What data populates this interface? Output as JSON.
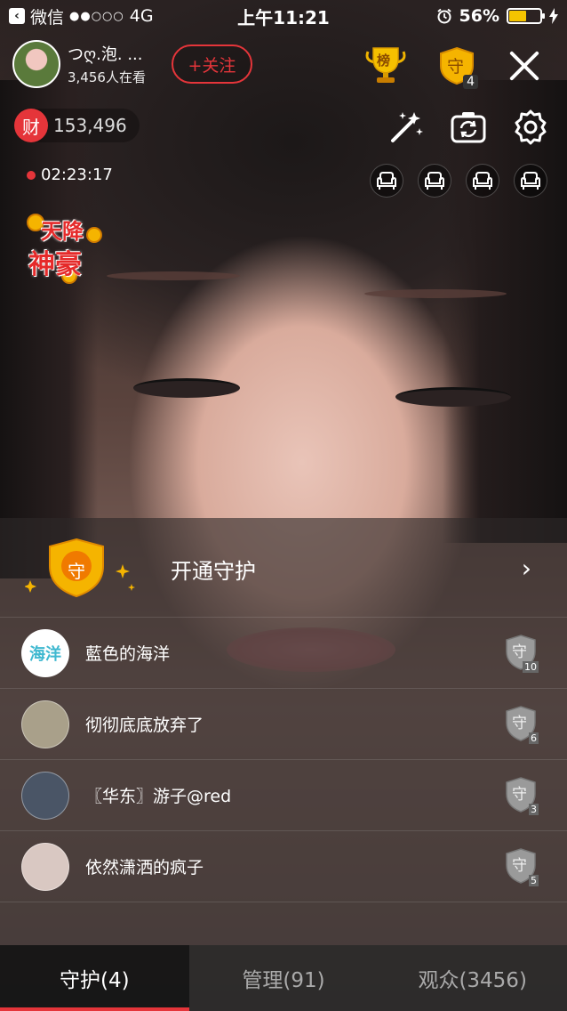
{
  "status_bar": {
    "carrier": "微信",
    "signal_dots": "●●○○○",
    "network": "4G",
    "time": "上午11:21",
    "battery_percent": "56%",
    "battery_level": 0.56
  },
  "host": {
    "name": "つღ.泡. ...",
    "viewers": "3,456人在看",
    "follow_label": "+关注"
  },
  "top_right": {
    "rank_label": "榜",
    "guard_label": "守",
    "guard_count": "4"
  },
  "wealth": {
    "icon_label": "财",
    "value": "153,496"
  },
  "live_duration": "02:23:17",
  "promo": {
    "line1": "天降",
    "line2": "神豪"
  },
  "guard_panel": {
    "open_label": "开通守护",
    "shield_label": "守",
    "rows": [
      {
        "name": "藍色的海洋",
        "avatar_text": "海洋",
        "level": "10",
        "avatar_color": "#4fc3d9"
      },
      {
        "name": "彻彻底底放弃了",
        "avatar_text": "",
        "level": "6",
        "avatar_color": "#a9a08a"
      },
      {
        "name": "〖华东〗游子@red",
        "avatar_text": "",
        "level": "3",
        "avatar_color": "#4a5566"
      },
      {
        "name": "依然潇洒的疯子",
        "avatar_text": "",
        "level": "5",
        "avatar_color": "#d9c8c2"
      }
    ]
  },
  "tabs": [
    {
      "label": "守护(4)",
      "active": true
    },
    {
      "label": "管理(91)",
      "active": false
    },
    {
      "label": "观众(3456)",
      "active": false
    }
  ],
  "colors": {
    "accent_red": "#e5353a",
    "gold": "#f5b400",
    "battery_yellow": "#f5c400"
  }
}
